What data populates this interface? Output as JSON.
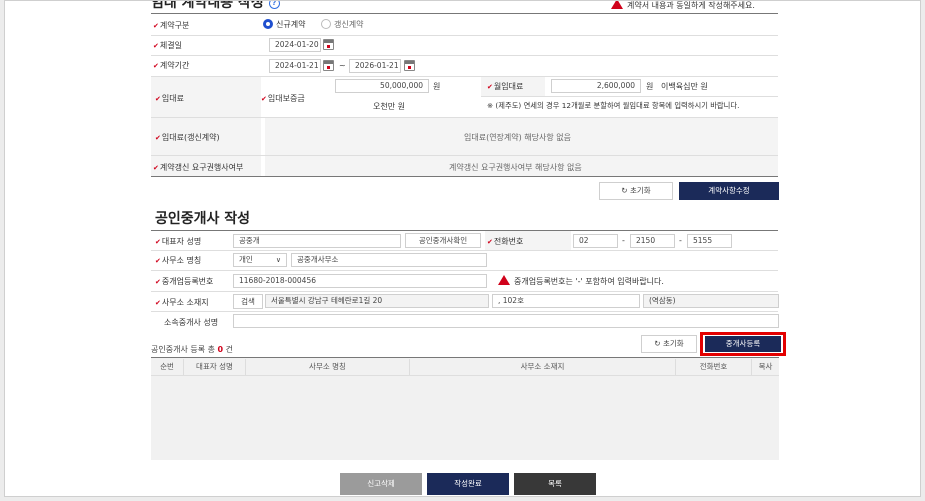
{
  "section1": {
    "title": "임대 계약내용 작성",
    "notice": "계약서 내용과 동일하게 작성해주세요.",
    "rows": {
      "contract_type": {
        "label": "계약구분",
        "options": [
          "신규계약",
          "갱신계약"
        ],
        "selected": "신규계약"
      },
      "conclusion_date": {
        "label": "체결일",
        "value": "2024-01-20"
      },
      "period": {
        "label": "계약기간",
        "from": "2024-01-21",
        "tilde": "~",
        "to": "2026-01-21"
      },
      "rent": {
        "label": "임대료",
        "deposit_label": "임대보증금",
        "deposit_value": "50,000,000",
        "deposit_unit": "원",
        "deposit_words": "오천만 원",
        "monthly_label": "월임대료",
        "monthly_value": "2,600,000",
        "monthly_unit": "원",
        "monthly_words": "이백육십만 원",
        "monthly_note": "※ (제주도) 연세의 경우 12개월로 분할하여 월임대료 항목에 입력하시기 바랍니다."
      },
      "renewal_rent": {
        "label": "임대료(갱신계약)",
        "value": "임대료(연장계약) 해당사항 없음"
      },
      "renewal_right": {
        "label": "계약갱신 요구권행사여부",
        "value": "계약갱신 요구권행사여부 해당사항 없음"
      }
    },
    "reset_label": "초기화",
    "modify_label": "계약사항수정"
  },
  "section2": {
    "title": "공인중개사 작성",
    "rep_name": {
      "label": "대표자 성명",
      "value": "공중개",
      "verify_label": "공인중개사확인"
    },
    "phone": {
      "label": "전화번호",
      "part1": "02",
      "part2": "2150",
      "part3": "5155",
      "dash": "-"
    },
    "office_name": {
      "label": "사무소 명칭",
      "type": "개인",
      "value": "공중개사무소"
    },
    "reg_no": {
      "label": "중개업등록번호",
      "value": "11680-2018-000456",
      "warn": "중개업등록번호는 '-' 포함하여 입력바랍니다."
    },
    "address": {
      "label": "사무소 소재지",
      "search_label": "검색",
      "road": "서울특별시 강남구 테헤란로1길 20",
      "detail": ", 102호",
      "extra": "(역삼동)"
    },
    "affiliated": {
      "label": "소속중개사 성명",
      "value": ""
    },
    "reset_label": "초기화",
    "register_label": "중개사등록"
  },
  "registry": {
    "count_prefix": "공인중개사 등록 총",
    "count": "0",
    "count_suffix": "건",
    "columns": [
      "순번",
      "대표자 성명",
      "사무소 명칭",
      "사무소 소재지",
      "전화번호",
      "복사"
    ]
  },
  "footer": {
    "delete_label": "신고삭제",
    "complete_label": "작성완료",
    "list_label": "목록"
  },
  "colors": {
    "accent_navy": "#1b2a59",
    "required_red": "#d0021b",
    "highlight_box": "#e30000"
  }
}
